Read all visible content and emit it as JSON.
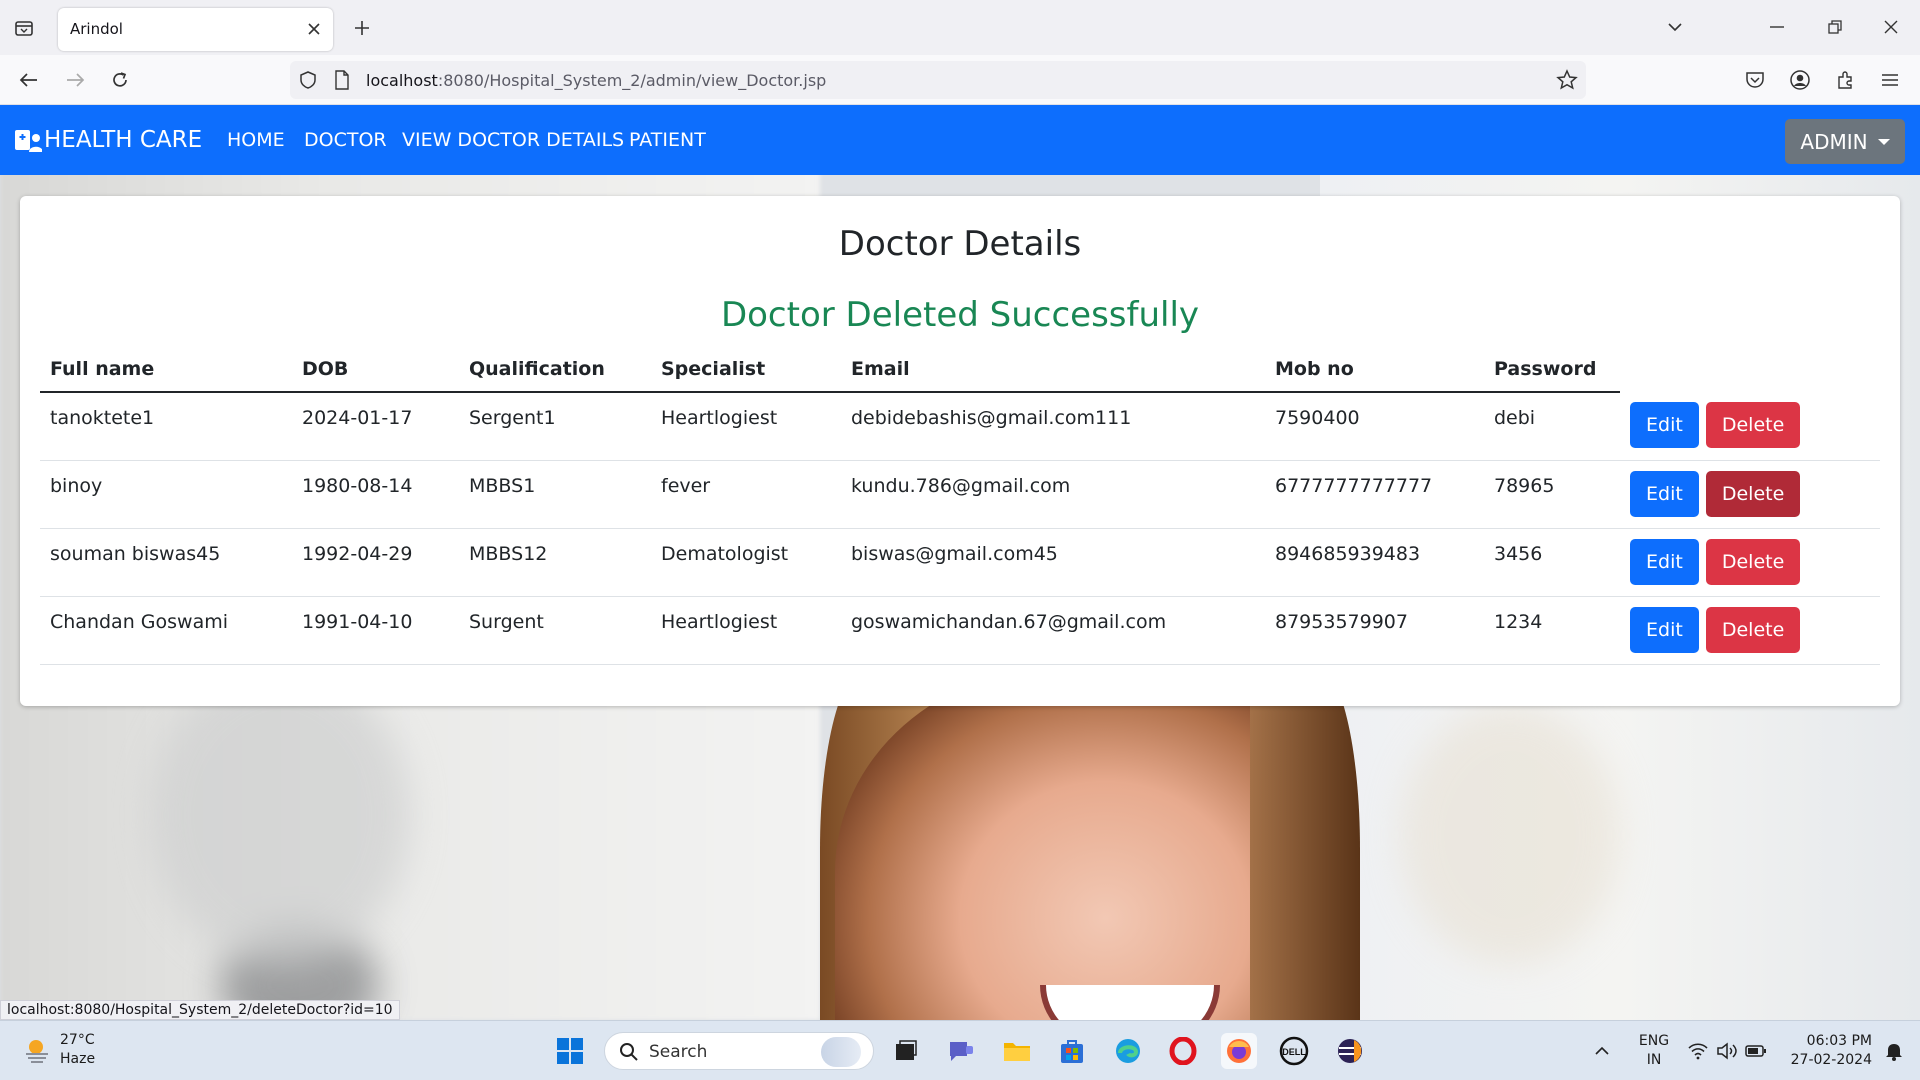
{
  "browser": {
    "tab_title": "Arindol",
    "url_host": "localhost",
    "url_rest": ":8080/Hospital_System_2/admin/view_Doctor.jsp",
    "status_url": "localhost:8080/Hospital_System_2/deleteDoctor?id=10"
  },
  "app": {
    "brand": "HEALTH CARE",
    "nav": [
      "HOME",
      "DOCTOR",
      "VIEW DOCTOR DETAILS",
      "PATIENT"
    ],
    "admin_label": "ADMIN",
    "accent": "#0d6efd"
  },
  "card": {
    "title": "Doctor Details",
    "message": "Doctor Deleted Successfully",
    "message_color": "#198754"
  },
  "table": {
    "headers": [
      "Full name",
      "DOB",
      "Qualification",
      "Specialist",
      "Email",
      "Mob no",
      "Password"
    ],
    "rows": [
      [
        "tanoktete1",
        "2024-01-17",
        "Sergent1",
        "Heartlogiest",
        "debidebashis@gmail.com111",
        "7590400",
        "debi"
      ],
      [
        "binoy",
        "1980-08-14",
        "MBBS1",
        "fever",
        "kundu.786@gmail.com",
        "6777777777777",
        "78965"
      ],
      [
        "souman biswas45",
        "1992-04-29",
        "MBBS12",
        "Dematologist",
        "biswas@gmail.com45",
        "894685939483",
        "3456"
      ],
      [
        "Chandan Goswami",
        "1991-04-10",
        "Surgent",
        "Heartlogiest",
        "goswamichandan.67@gmail.com",
        "87953579907",
        "1234"
      ]
    ],
    "edit_label": "Edit",
    "delete_label": "Delete"
  },
  "taskbar": {
    "temperature": "27°C",
    "weather": "Haze",
    "search_placeholder": "Search",
    "lang_1": "ENG",
    "lang_2": "IN",
    "time": "06:03 PM",
    "date": "27-02-2024"
  }
}
